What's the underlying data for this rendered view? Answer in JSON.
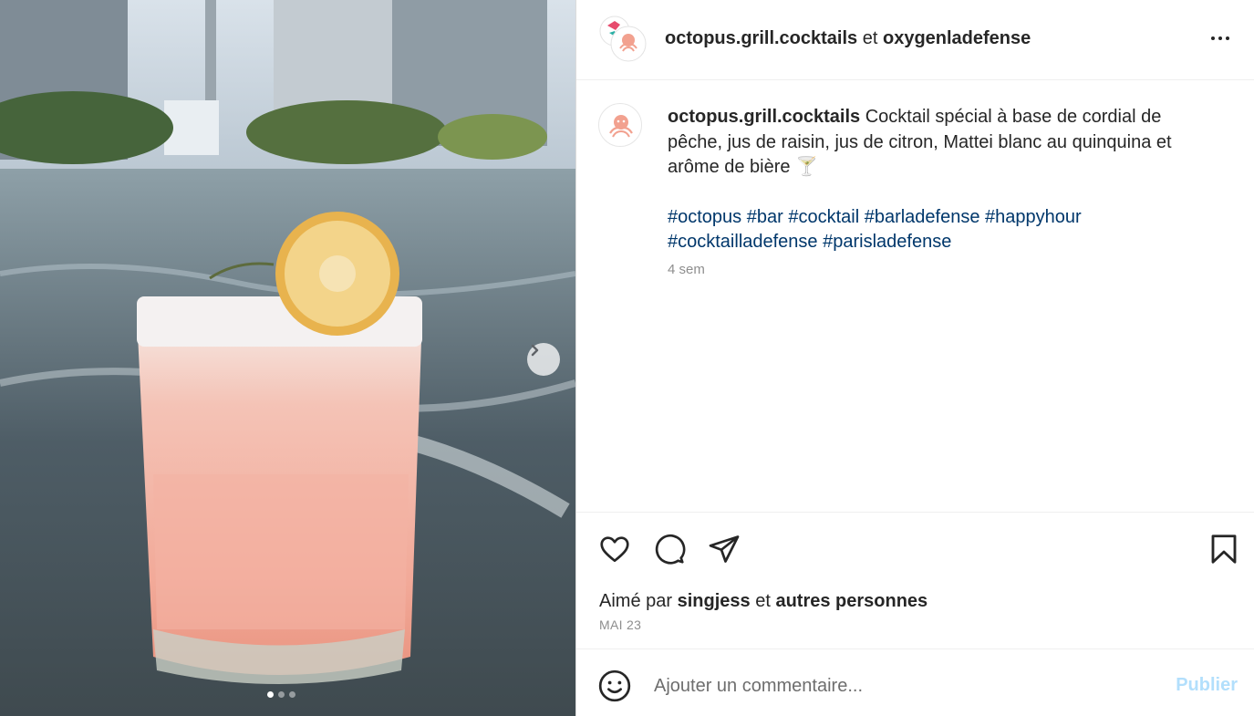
{
  "header": {
    "author": "octopus.grill.cocktails",
    "conjunction": "et",
    "collaborator": "oxygenladefense"
  },
  "caption": {
    "username": "octopus.grill.cocktails",
    "text": "Cocktail spécial à base de cordial de pêche, jus de raisin, jus de citron, Mattei blanc au quinquina et arôme de bière 🍸",
    "hashtags": [
      "#octopus",
      "#bar",
      "#cocktail",
      "#barladefense",
      "#happyhour",
      "#cocktailladefense",
      "#parisladefense"
    ],
    "time": "4 sem"
  },
  "likes": {
    "prefix": "Aimé par",
    "user": "singjess",
    "conjunction": "et",
    "others": "autres personnes"
  },
  "date": "MAI 23",
  "comment": {
    "placeholder": "Ajouter un commentaire...",
    "submit_label": "Publier"
  },
  "media": {
    "carousel_count": 3,
    "active_index": 0
  },
  "colors": {
    "hashtag": "#00376b",
    "publish_disabled": "#b2dffc",
    "secondary_text": "#8e8e8e",
    "brand_octopus": "#f2a18f"
  }
}
